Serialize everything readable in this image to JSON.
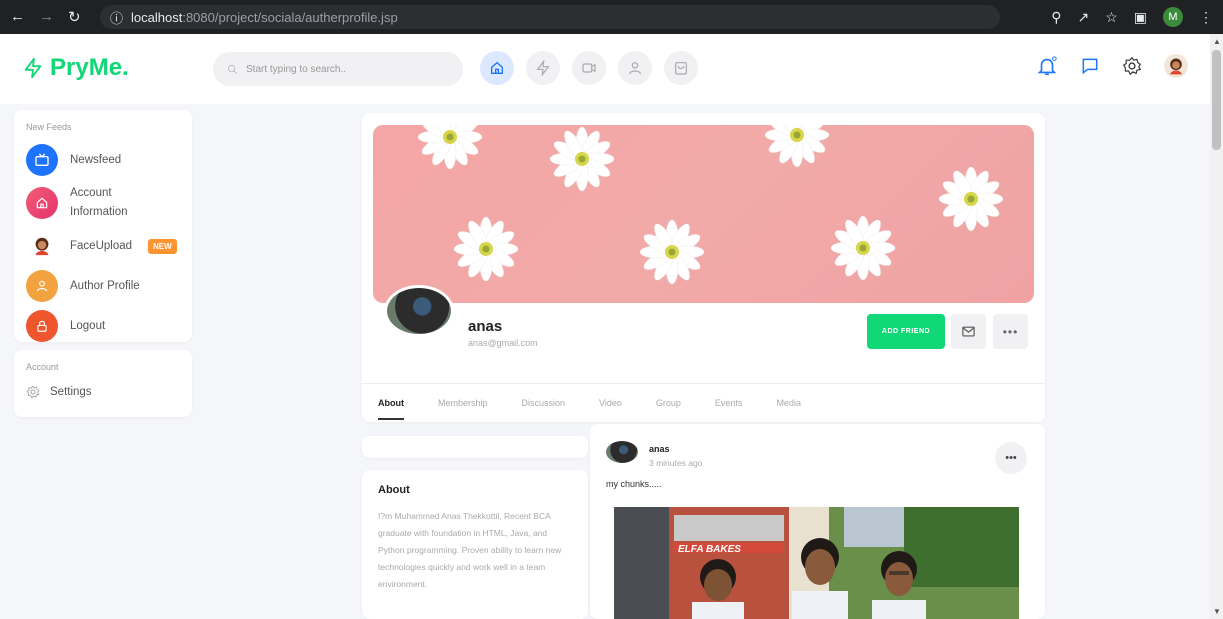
{
  "browser": {
    "url_host": "localhost",
    "url_path": ":8080/project/sociala/autherprofile.jsp",
    "profile_initial": "M"
  },
  "header": {
    "brand": "PryMe.",
    "search_placeholder": "Start typing to search..",
    "accent": "#10d876"
  },
  "sidebar": {
    "section1_title": "New Feeds",
    "items": [
      {
        "label": "Newsfeed",
        "icon": "tv-icon",
        "color": "#1e74fd"
      },
      {
        "label": "Account Information",
        "icon": "home-icon",
        "color": "#e44d6d"
      },
      {
        "label": "FaceUpload",
        "icon": "avatar-icon",
        "badge": "NEW"
      },
      {
        "label": "Author Profile",
        "icon": "user-icon",
        "color": "#f2a340"
      },
      {
        "label": "Logout",
        "icon": "lock-icon",
        "color": "#f0562e"
      }
    ],
    "section2_title": "Account",
    "settings_label": "Settings"
  },
  "profile": {
    "name": "anas",
    "email": "anas@gmail.com",
    "add_friend": "ADD FRIEND",
    "tabs": [
      "About",
      "Membership",
      "Discussion",
      "Video",
      "Group",
      "Events",
      "Media"
    ],
    "active_tab": "About"
  },
  "about": {
    "title": "About",
    "text": "I?m Muhammed Anas Thekkottil, Recent BCA graduate with foundation in HTML, Java, and Python programming. Proven ability to learn new technologies quickly and work well in a team environment."
  },
  "post": {
    "author": "anas",
    "time": "3 minutes ago",
    "text": "my chunks.....",
    "photo_sign": "ELFA BAKES"
  }
}
